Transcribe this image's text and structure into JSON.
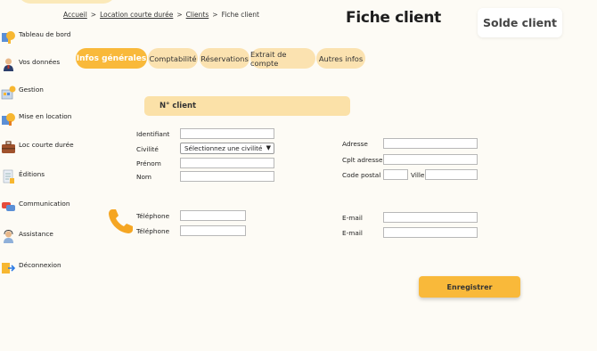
{
  "breadcrumb": {
    "home": "Accueil",
    "section": "Location courte durée",
    "clients": "Clients",
    "current": "Fiche client",
    "separator": ">"
  },
  "page_title": "Fiche client",
  "solde_button": "Solde client",
  "sidebar": {
    "items": [
      {
        "label": "Tableau de bord",
        "icon": "dashboard-icon"
      },
      {
        "label": "Vos données",
        "icon": "user-icon"
      },
      {
        "label": "Gestion",
        "icon": "management-icon"
      },
      {
        "label": "Mise en location",
        "icon": "rental-icon"
      },
      {
        "label": "Loc courte durée",
        "icon": "suitcase-icon"
      },
      {
        "label": "Éditions",
        "icon": "document-icon"
      },
      {
        "label": "Communication",
        "icon": "chat-icon"
      },
      {
        "label": "Assistance",
        "icon": "support-icon"
      },
      {
        "label": "Déconnexion",
        "icon": "logout-icon"
      }
    ]
  },
  "tabs": [
    {
      "label": "Infos générales",
      "active": true
    },
    {
      "label": "Comptabilité",
      "active": false
    },
    {
      "label": "Réservations",
      "active": false
    },
    {
      "label": "Extrait de compte",
      "active": false
    },
    {
      "label": "Autres infos",
      "active": false
    }
  ],
  "section_header": "N° client",
  "form": {
    "identifiant": {
      "label": "Identifiant",
      "value": ""
    },
    "civilite": {
      "label": "Civilité",
      "selected": "Sélectionnez une civilité"
    },
    "prenom": {
      "label": "Prénom",
      "value": ""
    },
    "nom": {
      "label": "Nom",
      "value": ""
    },
    "adresse": {
      "label": "Adresse",
      "value": ""
    },
    "cplt_adresse": {
      "label": "Cplt adresse",
      "value": ""
    },
    "code_postal": {
      "label": "Code postal",
      "value": ""
    },
    "ville": {
      "label": "Ville",
      "value": ""
    },
    "telephone1": {
      "label": "Téléphone",
      "value": ""
    },
    "telephone2": {
      "label": "Téléphone",
      "value": ""
    },
    "email1": {
      "label": "E-mail",
      "value": ""
    },
    "email2": {
      "label": "E-mail",
      "value": ""
    }
  },
  "save_button": "Enregistrer",
  "colors": {
    "accent": "#f9b93a",
    "tab_bg": "#fbe2b0",
    "section_bg": "#fbe1a8",
    "background": "#fdfbf5",
    "phone_icon": "#f5a623"
  }
}
